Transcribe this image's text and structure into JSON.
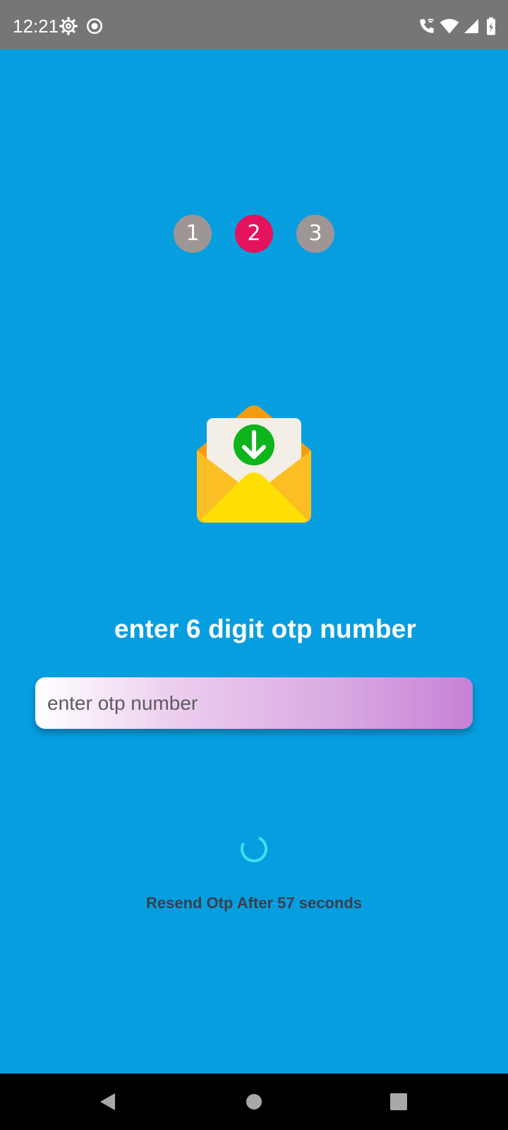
{
  "status_bar": {
    "time": "12:21",
    "icons": [
      "settings-icon",
      "record-icon",
      "wifi-call-icon",
      "wifi-icon",
      "signal-icon",
      "battery-icon"
    ]
  },
  "stepper": {
    "steps": [
      "1",
      "2",
      "3"
    ],
    "active_step": 2,
    "active_color": "#e5125e",
    "inactive_color": "#9e9595"
  },
  "illustration": {
    "icon": "envelope-download-icon"
  },
  "headline": "enter 6 digit otp number",
  "otp_input": {
    "placeholder": "enter otp number",
    "value": ""
  },
  "loading": {
    "icon": "spinner-icon"
  },
  "resend_text": "Resend Otp After 57 seconds",
  "nav_bar": {
    "icons": [
      "back-icon",
      "home-icon",
      "recents-icon"
    ]
  },
  "colors": {
    "background": "#079ee0",
    "status_bar": "#767676"
  }
}
